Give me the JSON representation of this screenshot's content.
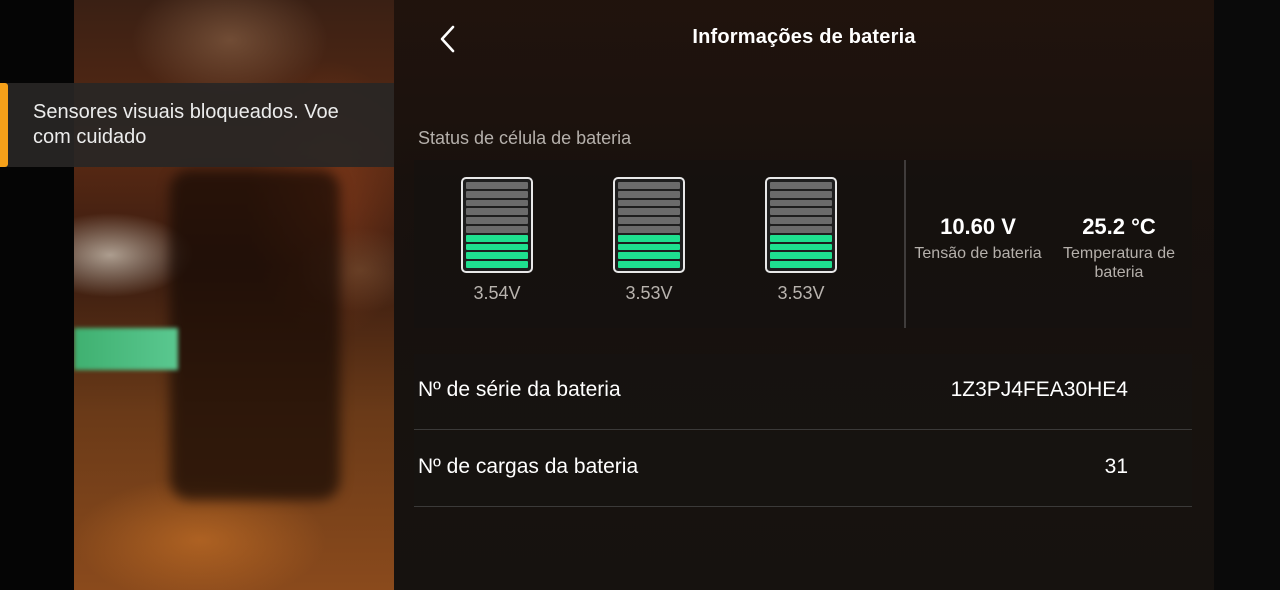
{
  "header": {
    "title": "Informações de bateria",
    "back_icon": "chevron-left-icon"
  },
  "warning": {
    "message": "Sensores visuais bloqueados. Voe com cuidado",
    "accent_color": "#f5a019"
  },
  "cells_section": {
    "label": "Status de célula de bateria",
    "cells": [
      {
        "voltage": "3.54V",
        "fill_fraction": 0.4
      },
      {
        "voltage": "3.53V",
        "fill_fraction": 0.4
      },
      {
        "voltage": "3.53V",
        "fill_fraction": 0.4
      }
    ],
    "full_color": "#1ee08f",
    "empty_color": "#6b6b6b"
  },
  "metrics": {
    "voltage_value": "10.60 V",
    "voltage_label": "Tensão de bateria",
    "temperature_value": "25.2 °C",
    "temperature_label": "Temperatura de bateria"
  },
  "details": {
    "serial_label": "Nº de série da bateria",
    "serial_value": "1Z3PJ4FEA30HE4",
    "cycles_label": "Nº de cargas da bateria",
    "cycles_value": "31"
  }
}
